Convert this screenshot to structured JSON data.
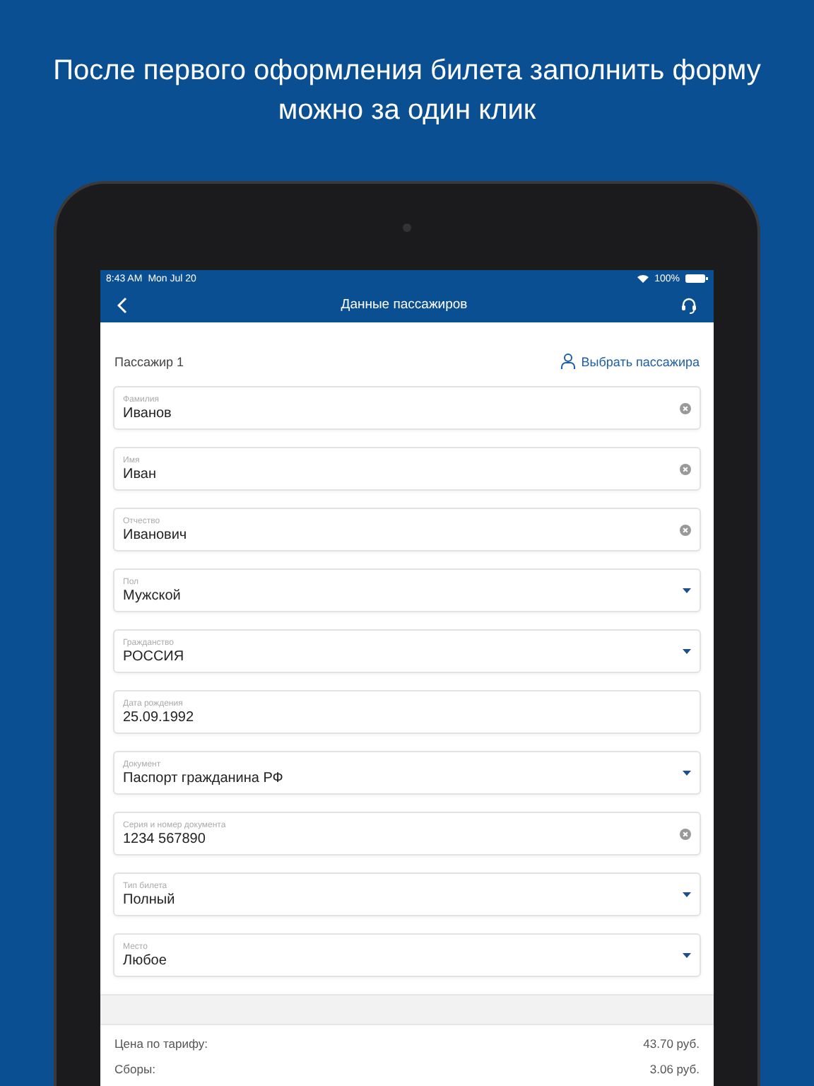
{
  "headline": "После первого оформления билета заполнить форму можно за один клик",
  "status_bar": {
    "time": "8:43 AM",
    "date": "Mon Jul 20",
    "battery": "100%"
  },
  "nav_bar": {
    "title": "Данные пассажиров"
  },
  "passenger": {
    "label": "Пассажир 1",
    "action": "Выбрать пассажира"
  },
  "fields": [
    {
      "label": "Фамилия",
      "value": "Иванов",
      "kind": "clearable"
    },
    {
      "label": "Имя",
      "value": "Иван",
      "kind": "clearable"
    },
    {
      "label": "Отчество",
      "value": "Иванович",
      "kind": "clearable"
    },
    {
      "label": "Пол",
      "value": "Мужской",
      "kind": "dropdown"
    },
    {
      "label": "Гражданство",
      "value": "РОССИЯ",
      "kind": "dropdown"
    },
    {
      "label": "Дата рождения",
      "value": "25.09.1992",
      "kind": "plain"
    },
    {
      "label": "Документ",
      "value": "Паспорт гражданина РФ",
      "kind": "dropdown"
    },
    {
      "label": "Серия и номер документа",
      "value": "1234 567890",
      "kind": "clearable"
    },
    {
      "label": "Тип билета",
      "value": "Полный",
      "kind": "dropdown"
    },
    {
      "label": "Место",
      "value": "Любое",
      "kind": "dropdown"
    }
  ],
  "prices": [
    {
      "label": "Цена по тарифу:",
      "value": "43.70 руб."
    },
    {
      "label": "Сборы:",
      "value": "3.06 руб."
    }
  ]
}
